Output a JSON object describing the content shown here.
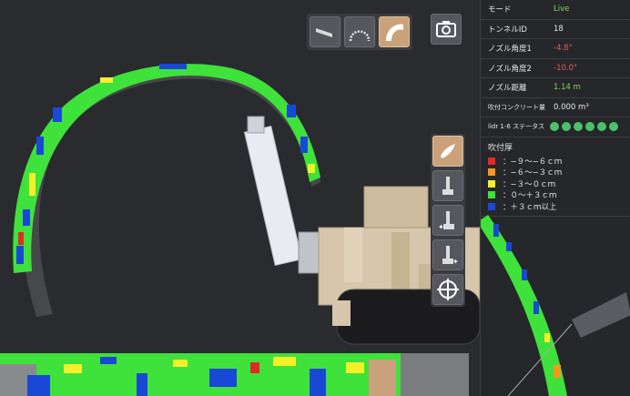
{
  "status": {
    "mode_label": "モード",
    "mode_value": "Live",
    "tunnel_label": "トンネルID",
    "tunnel_value": "18",
    "nozzle_angle1_label": "ノズル角度1",
    "nozzle_angle1_value": "-4.8°",
    "nozzle_angle2_label": "ノズル角度2",
    "nozzle_angle2_value": "-10.0°",
    "nozzle_dist_label": "ノズル距離",
    "nozzle_dist_value": "1.14 m",
    "concrete_label": "吹付コンクリート量",
    "concrete_value": "0.000 m³",
    "lidar_label": "lidr 1-6 ステータス",
    "lidar_states": [
      "ok",
      "ok",
      "ok",
      "ok",
      "ok",
      "ok"
    ]
  },
  "legend": {
    "title": "吹付厚",
    "items": [
      {
        "label": "：−９〜−６ｃｍ",
        "color": "#e02a2a"
      },
      {
        "label": "：−６〜−３ｃｍ",
        "color": "#f39a1e"
      },
      {
        "label": "：−３〜０ｃｍ",
        "color": "#f5ef2a"
      },
      {
        "label": "：０〜＋３ｃｍ",
        "color": "#3ee23a"
      },
      {
        "label": "：＋３ｃｍ以上",
        "color": "#1a48d6"
      }
    ]
  },
  "icons": {
    "view_buttons": [
      "flat-view-icon",
      "arch-view-icon",
      "curved-view-icon"
    ],
    "camera": "camera-icon",
    "side_buttons": [
      "spray-icon",
      "nozzle-mode-1-icon",
      "nozzle-mode-2-icon",
      "nozzle-mode-3-icon",
      "target-icon"
    ]
  }
}
